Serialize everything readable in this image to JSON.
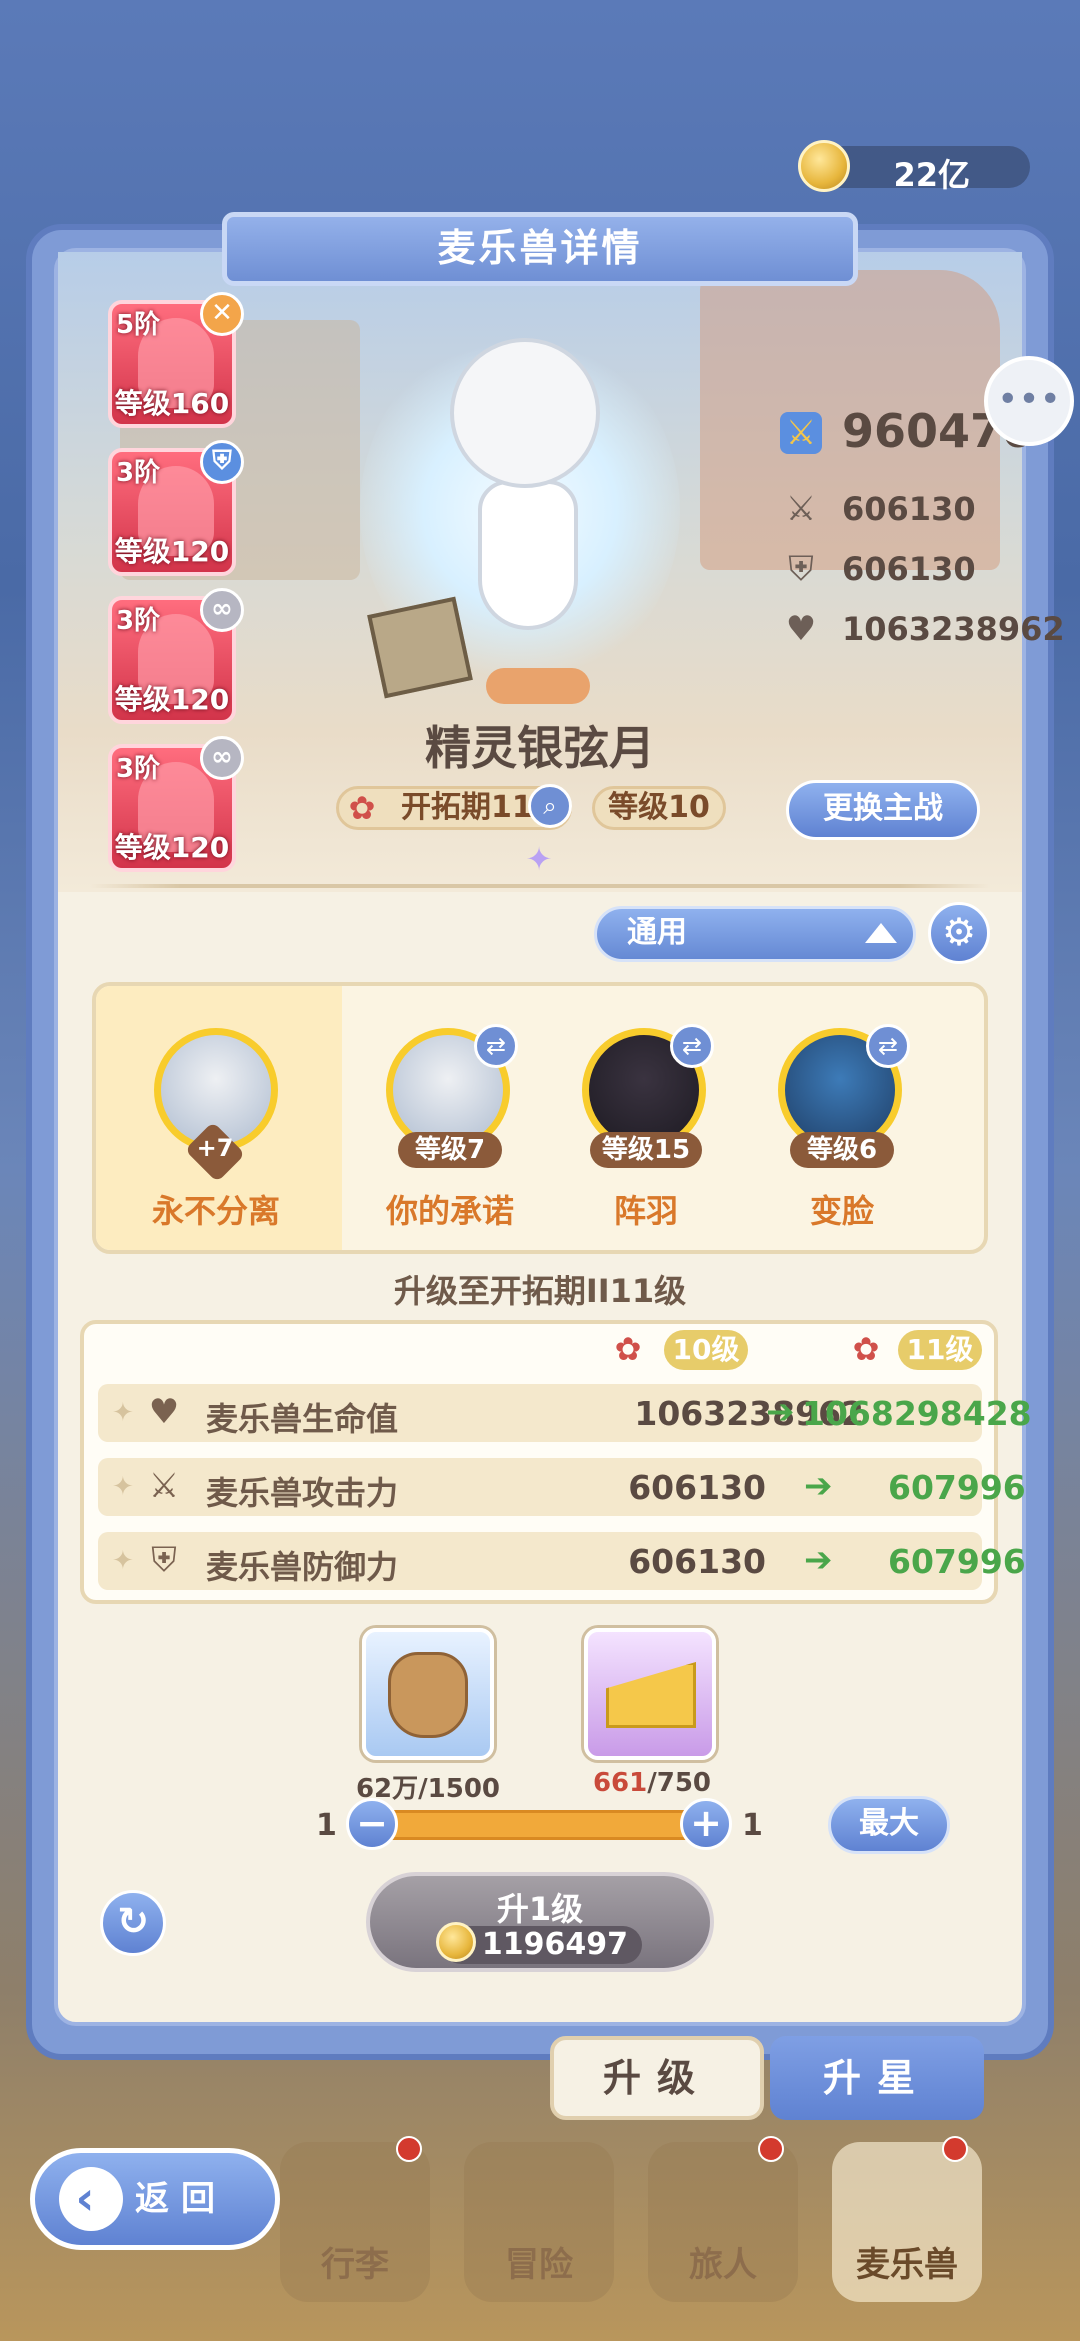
{
  "currency": {
    "amount": "22亿",
    "icon": "coin-icon"
  },
  "title": "麦乐兽详情",
  "cards": [
    {
      "tier": "5阶",
      "level": "等级160",
      "badge": "✕",
      "badge_color": "#f3a54a"
    },
    {
      "tier": "3阶",
      "level": "等级120",
      "badge": "⛨",
      "badge_color": "#5b8fe0"
    },
    {
      "tier": "3阶",
      "level": "等级120",
      "badge": "∞",
      "badge_color": "#b6b6c2"
    },
    {
      "tier": "3阶",
      "level": "等级120",
      "badge": "∞",
      "badge_color": "#b6b6c2"
    }
  ],
  "character": {
    "name": "精灵银弦月",
    "stage": "开拓期11",
    "level": "等级10",
    "switch_label": "更换主战"
  },
  "stats": {
    "power": "960470",
    "attack": "606130",
    "defense": "606130",
    "hp": "1063238962"
  },
  "dropdown": {
    "value": "通用"
  },
  "skills": [
    {
      "name": "永不分离",
      "badge": "+7",
      "selected": true
    },
    {
      "name": "你的承诺",
      "level": "等级7"
    },
    {
      "name": "阵羽",
      "level": "等级15"
    },
    {
      "name": "变脸",
      "level": "等级6"
    }
  ],
  "upgrade": {
    "title": "升级至开拓期II11级",
    "from_level": "10级",
    "to_level": "11级",
    "rows": [
      {
        "label": "麦乐兽生命值",
        "old": "1063238962",
        "new": "1068298428"
      },
      {
        "label": "麦乐兽攻击力",
        "old": "606130",
        "new": "607996"
      },
      {
        "label": "麦乐兽防御力",
        "old": "606130",
        "new": "607996"
      }
    ]
  },
  "materials": [
    {
      "amount": "62万",
      "required": "/1500"
    },
    {
      "amount": "661",
      "required": "/750",
      "amount_color": "#c94a3a"
    }
  ],
  "slider": {
    "min": "1",
    "max": "1",
    "max_label": "最大"
  },
  "upgrade_button": {
    "label": "升1级",
    "cost": "1196497"
  },
  "tabs": {
    "upgrade": "升级",
    "star": "升星"
  },
  "nav": {
    "back": "返回",
    "items": [
      "行李",
      "冒险",
      "旅人",
      "麦乐兽"
    ]
  }
}
